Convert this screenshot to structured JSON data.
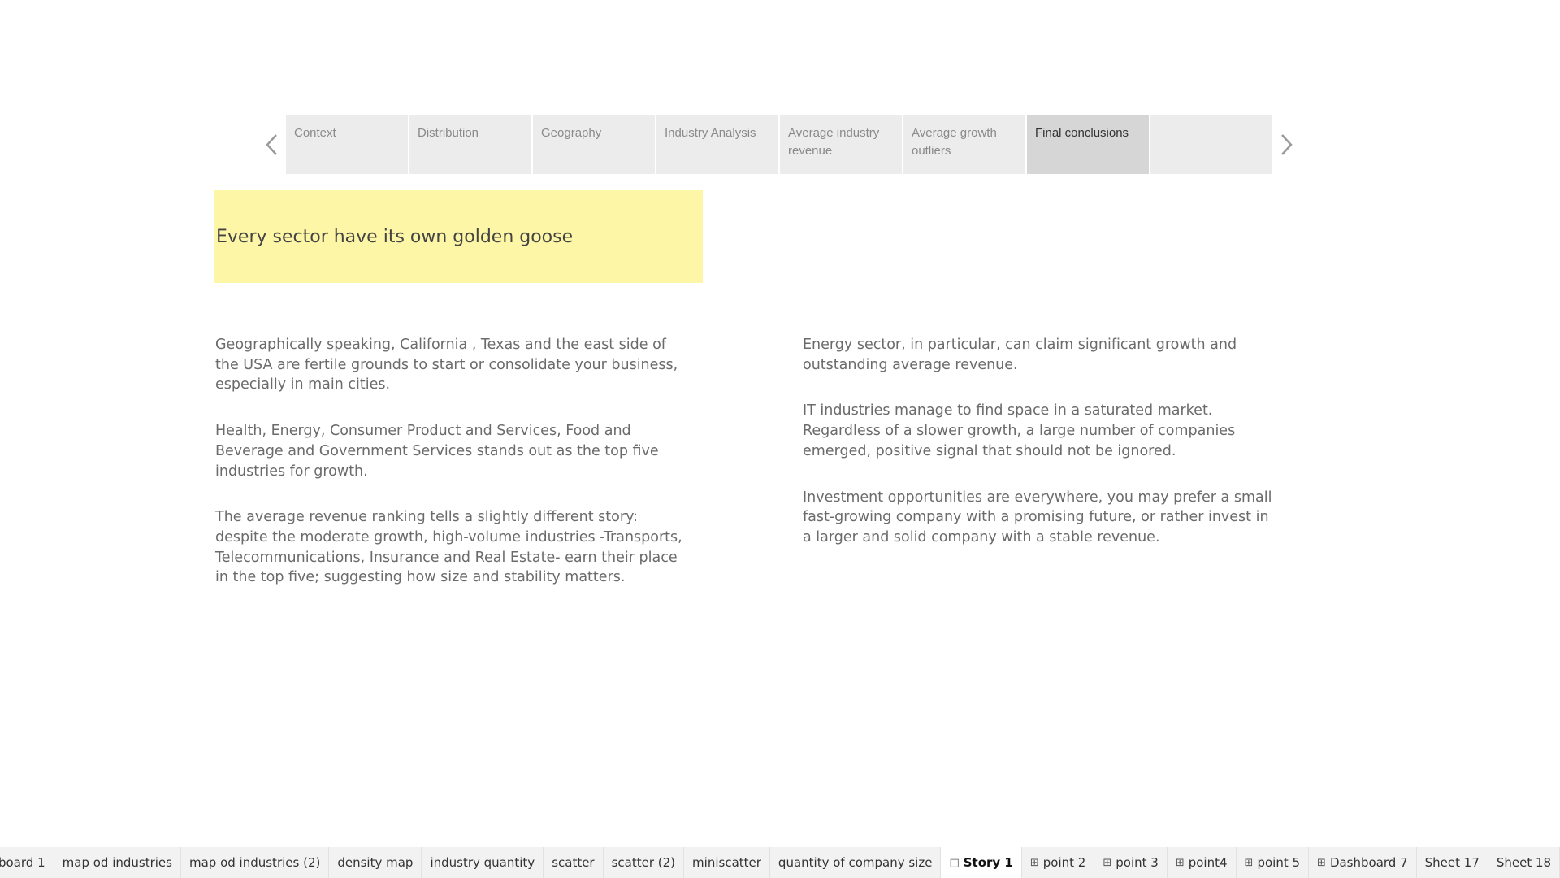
{
  "story": {
    "points": [
      {
        "label": "Context"
      },
      {
        "label": "Distribution"
      },
      {
        "label": "Geography"
      },
      {
        "label": "Industry Analysis"
      },
      {
        "label": "Average industry revenue"
      },
      {
        "label": "Average growth outliers"
      },
      {
        "label": "Final conclusions",
        "active": true
      },
      {
        "label": ""
      }
    ]
  },
  "title": "Every sector have its own golden goose",
  "left_column": [
    "Geographically speaking, California , Texas and the east side of the USA are fertile grounds to start or consolidate your business, especially in main cities.",
    "Health, Energy, Consumer Product and Services, Food and Beverage and Government Services stands out as the top five industries for growth.",
    "The average revenue ranking tells a slightly different story: despite the moderate growth, high-volume industries -Transports, Telecommunications, Insurance and Real Estate- earn their place in the top five; suggesting how size and stability matters."
  ],
  "right_column": [
    "Energy sector, in particular, can claim significant growth and outstanding average revenue.",
    "IT industries manage to find space in a saturated market. Regardless of a slower growth, a large number of companies emerged, positive signal that should not be ignored.",
    "Investment opportunities are everywhere, you may prefer a small fast-growing company with a promising future, or rather invest in a larger and solid company with a stable revenue."
  ],
  "bottom_tabs": [
    {
      "label": "board 1",
      "icon": ""
    },
    {
      "label": "map od industries",
      "icon": ""
    },
    {
      "label": "map od industries (2)",
      "icon": ""
    },
    {
      "label": "density map",
      "icon": ""
    },
    {
      "label": "industry quantity",
      "icon": ""
    },
    {
      "label": "scatter",
      "icon": ""
    },
    {
      "label": "scatter (2)",
      "icon": ""
    },
    {
      "label": "miniscatter",
      "icon": ""
    },
    {
      "label": "quantity of company size",
      "icon": ""
    },
    {
      "label": "Story 1",
      "icon": "story-icon",
      "active": true
    },
    {
      "label": "point 2",
      "icon": "dashboard-icon"
    },
    {
      "label": "point 3",
      "icon": "dashboard-icon"
    },
    {
      "label": "point4",
      "icon": "dashboard-icon"
    },
    {
      "label": "point 5",
      "icon": "dashboard-icon"
    },
    {
      "label": "Dashboard 7",
      "icon": "dashboard-icon"
    },
    {
      "label": "Sheet 17",
      "icon": ""
    },
    {
      "label": "Sheet 18",
      "icon": ""
    }
  ],
  "colors": {
    "title_bg": "#fcf6a6",
    "active_point_bg": "#d6d6d6",
    "point_bg": "#ececec"
  }
}
